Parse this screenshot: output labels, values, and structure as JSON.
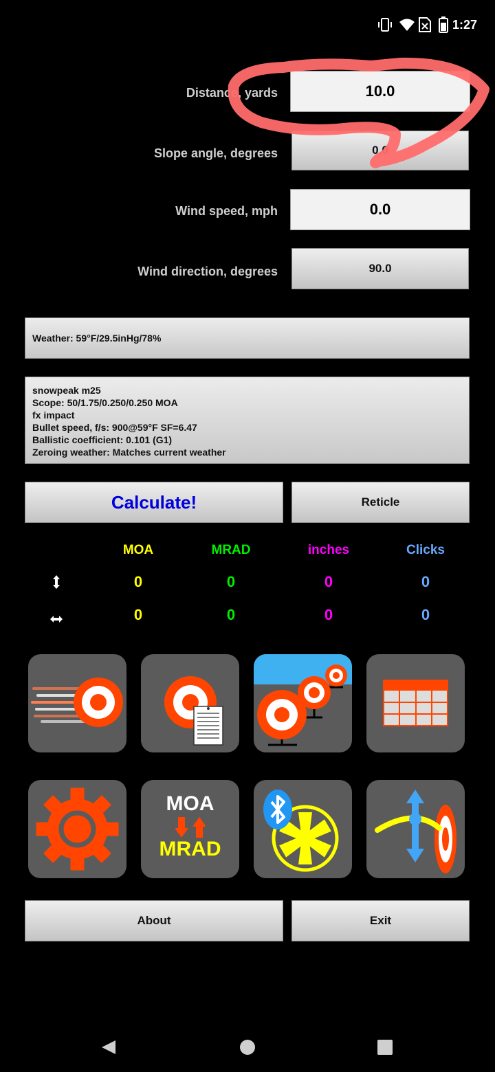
{
  "status": {
    "time": "1:27"
  },
  "inputs": {
    "distance": {
      "label": "Distance, yards",
      "value": "10.0"
    },
    "slope": {
      "label": "Slope angle, degrees",
      "value": "0.0"
    },
    "wind_speed": {
      "label": "Wind speed, mph",
      "value": "0.0"
    },
    "wind_dir": {
      "label": "Wind direction, degrees",
      "value": "90.0"
    }
  },
  "weather": "Weather: 59°F/29.5inHg/78%",
  "profile": {
    "lines": [
      "snowpeak m25",
      "Scope: 50/1.75/0.250/0.250 MOA",
      "fx impact",
      "Bullet speed, f/s: 900@59°F SF=6.47",
      "Ballistic coefficient: 0.101 (G1)",
      "Zeroing weather: Matches current weather"
    ]
  },
  "buttons": {
    "calculate": "Calculate!",
    "reticle": "Reticle",
    "about": "About",
    "exit": "Exit"
  },
  "results": {
    "headers": [
      "MOA",
      "MRAD",
      "inches",
      "Clicks"
    ],
    "colors": [
      "#ffff00",
      "#00ee00",
      "#ff00ff",
      "#66aaff"
    ],
    "vertical": [
      "0",
      "0",
      "0",
      "0"
    ],
    "horizontal": [
      "0",
      "0",
      "0",
      "0"
    ]
  },
  "tiles": {
    "conv_moa": "MOA",
    "conv_mrad": "MRAD"
  }
}
